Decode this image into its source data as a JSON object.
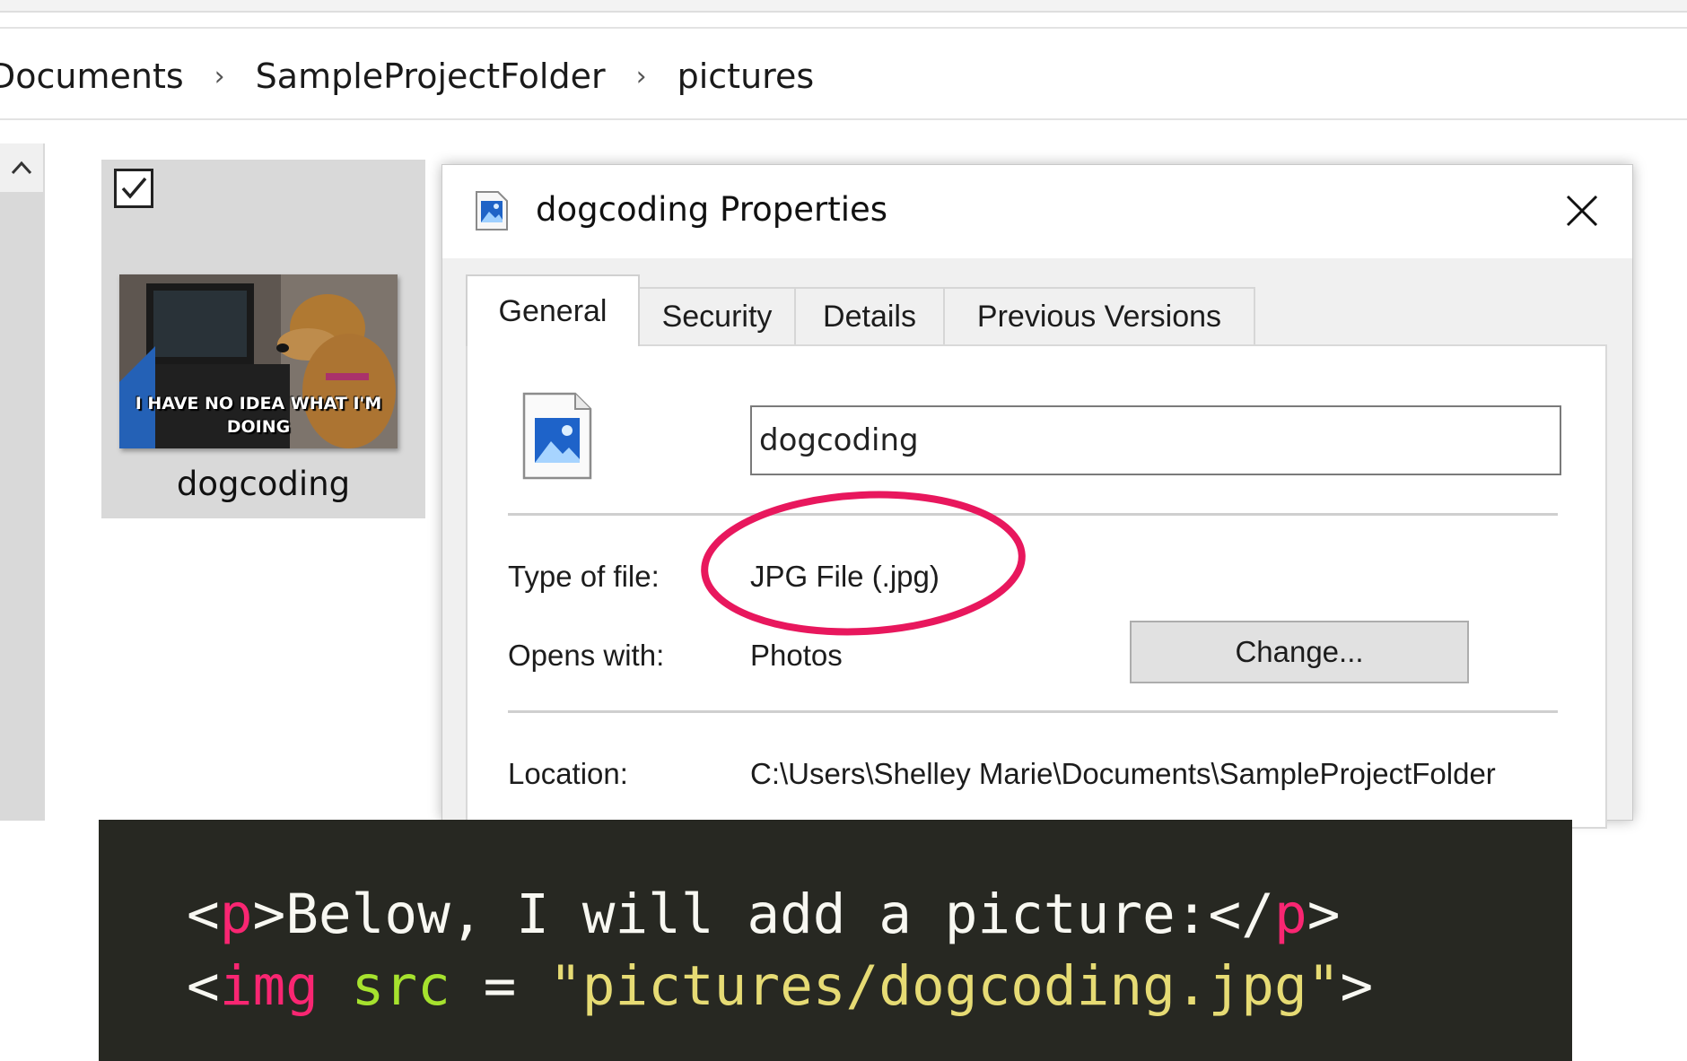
{
  "breadcrumb": {
    "items": [
      "Documents",
      "SampleProjectFolder",
      "pictures"
    ],
    "separator": "›"
  },
  "file_tile": {
    "name": "dogcoding",
    "selected": true,
    "thumbnail_caption": [
      "I HAVE NO IDEA WHAT I'M",
      "DOING"
    ]
  },
  "dialog": {
    "title": "dogcoding Properties",
    "tabs": [
      "General",
      "Security",
      "Details",
      "Previous Versions"
    ],
    "active_tab": "General",
    "file_name": "dogcoding",
    "type_of_file_label": "Type of file:",
    "type_of_file_value": "JPG File (.jpg)",
    "opens_with_label": "Opens with:",
    "opens_with_value": "Photos",
    "change_button": "Change...",
    "location_label": "Location:",
    "location_value": "C:\\Users\\Shelley Marie\\Documents\\SampleProjectFolder"
  },
  "code": {
    "line1": {
      "lt": "<",
      "tag": "p",
      "gt": ">",
      "text": "Below, I will add a picture:",
      "close_lt": "</",
      "close_tag": "p",
      "close_gt": ">"
    },
    "line2": {
      "lt": "<",
      "tag": "img",
      "attr": "src",
      "eq": " = ",
      "value": "\"pictures/dogcoding.jpg\"",
      "gt": ">"
    }
  },
  "colors": {
    "highlight": "#e8175d",
    "code_background": "#272822",
    "code_tag": "#f92672",
    "code_attr": "#a6e22e",
    "code_string": "#e6db74"
  }
}
